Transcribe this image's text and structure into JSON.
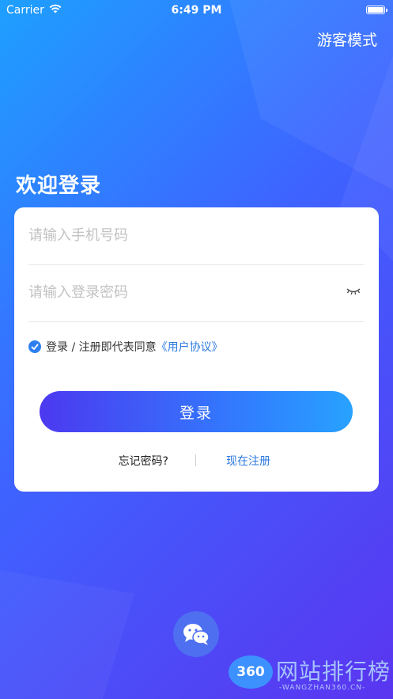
{
  "status_bar": {
    "carrier": "Carrier",
    "time": "6:49 PM",
    "icons": [
      "wifi-icon",
      "battery-icon"
    ]
  },
  "header": {
    "guest_mode": "游客模式"
  },
  "welcome": "欢迎登录",
  "form": {
    "phone_placeholder": "请输入手机号码",
    "phone_value": "",
    "password_placeholder": "请输入登录密码",
    "password_value": "",
    "agreement": {
      "checked": true,
      "prefix": "登录 / 注册即代表同意",
      "link": "《用户协议》"
    },
    "login_button": "登录",
    "forgot_password": "忘记密码?",
    "register_now": "现在注册"
  },
  "social": {
    "wechat_icon": "wechat-icon"
  },
  "watermark": {
    "logo": "360",
    "title": "网站排行榜",
    "subtitle": "-WANGZHAN360.CN-"
  },
  "colors": {
    "gradient_start": "#1ea0ff",
    "gradient_mid": "#3e63ff",
    "gradient_end": "#5a35f0",
    "link": "#2b79e0",
    "check": "#2d7ff0"
  }
}
